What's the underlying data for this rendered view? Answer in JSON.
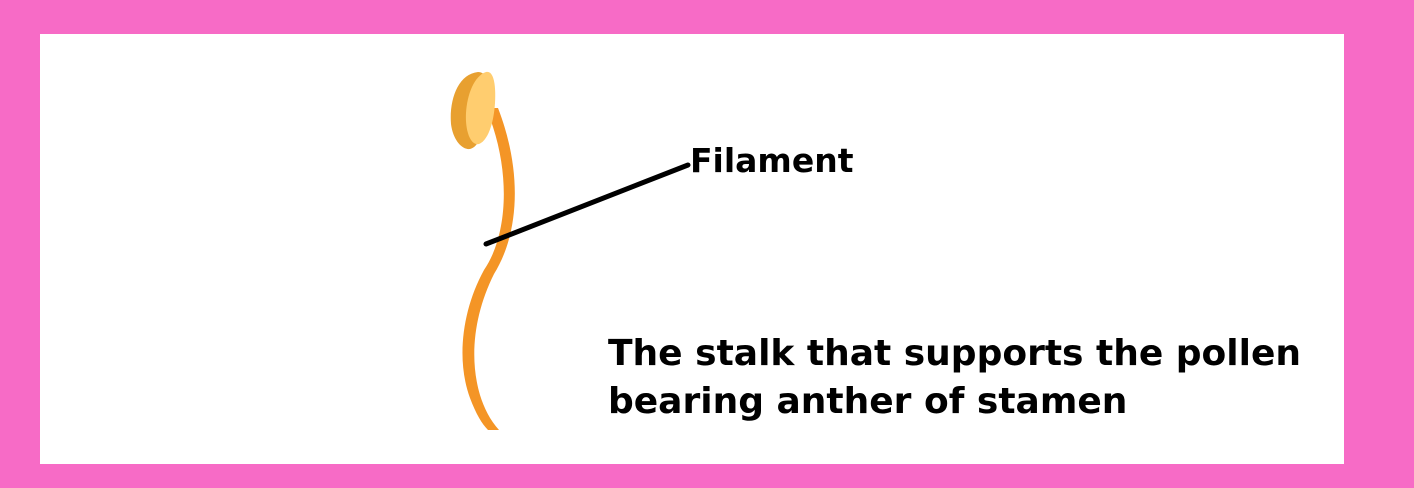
{
  "colors": {
    "border": "#f76bc6",
    "background": "#ffffff",
    "filament": "#f49526",
    "anther_dark": "#e8a030",
    "anther_light": "#ffcd6f",
    "text": "#000000",
    "leader_line": "#000000"
  },
  "diagram": {
    "label": "Filament",
    "description_lines": [
      "The stalk that supports the pollen",
      "bearing anther of stamen"
    ]
  }
}
